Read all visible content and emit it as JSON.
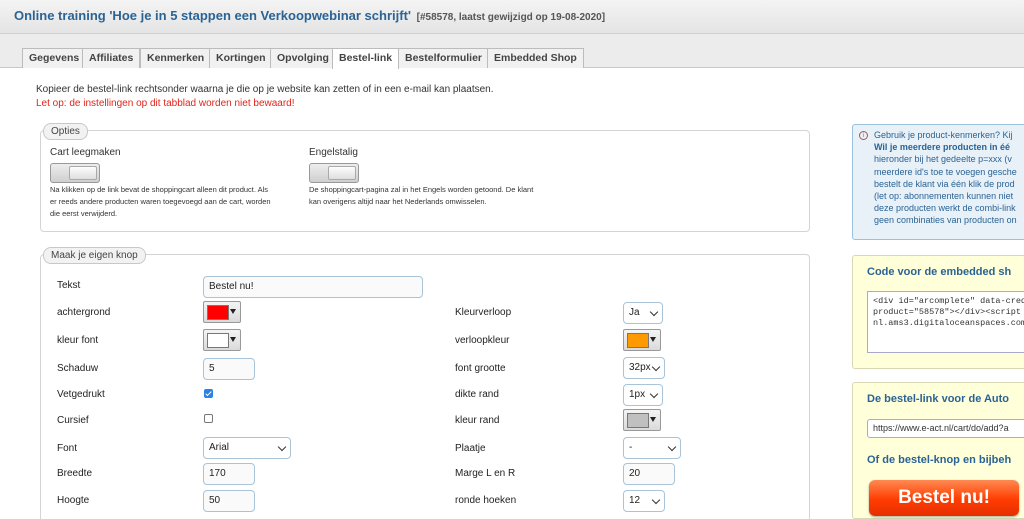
{
  "header": {
    "title": "Online training 'Hoe je in 5 stappen een Verkoopwebinar schrijft'",
    "meta": "[#58578, laatst gewijzigd op 19-08-2020]"
  },
  "tabs": [
    {
      "label": "Gegevens",
      "active": false
    },
    {
      "label": "Affiliates",
      "active": false
    },
    {
      "label": "Kenmerken",
      "active": false
    },
    {
      "label": "Kortingen",
      "active": false
    },
    {
      "label": "Opvolging",
      "active": false
    },
    {
      "label": "Bestel-link",
      "active": true
    },
    {
      "label": "Bestelformulier",
      "active": false
    },
    {
      "label": "Embedded Shop",
      "active": false
    }
  ],
  "intro": "Kopieer de bestel-link rechtsonder waarna je die op je website kan zetten of in een e-mail kan plaatsen.",
  "warning": "Let op: de instellingen op dit tabblad worden niet bewaard!",
  "options": {
    "legend": "Opties",
    "cart_clear": {
      "label": "Cart leegmaken",
      "help": [
        "Na klikken op de link bevat de shoppingcart alleen dit product. Als",
        "er reeds andere producten waren toegevoegd aan de cart, worden",
        "die eerst verwijderd."
      ]
    },
    "english": {
      "label": "Engelstalig",
      "help": [
        "De shoppingcart-pagina zal in het Engels worden getoond. De klant",
        "kan overigens altijd naar het Nederlands omwisselen."
      ]
    }
  },
  "button_builder": {
    "legend": "Maak je eigen knop",
    "text_label": "Tekst",
    "text_value": "Bestel nu!",
    "background_label": "achtergrond",
    "background_color": "#ff0000",
    "font_color_label": "kleur font",
    "font_color": "#ffffff",
    "shadow_label": "Schaduw",
    "shadow_value": "5",
    "bold_label": "Vetgedrukt",
    "bold_checked": true,
    "italic_label": "Cursief",
    "italic_checked": false,
    "font_label": "Font",
    "font_value": "Arial",
    "width_label": "Breedte",
    "width_value": "170",
    "height_label": "Hoogte",
    "height_value": "50",
    "gradient_label": "Kleurverloop",
    "gradient_value": "Ja",
    "gradient_color_label": "verloopkleur",
    "gradient_color": "#ff9900",
    "font_size_label": "font grootte",
    "font_size_value": "32px",
    "border_width_label": "dikte rand",
    "border_width_value": "1px",
    "border_color_label": "kleur rand",
    "border_color": "#c0c0c0",
    "image_label": "Plaatje",
    "image_value": "-",
    "margin_label": "Marge L en R",
    "margin_value": "20",
    "radius_label": "ronde hoeken",
    "radius_value": "12"
  },
  "info_panel": {
    "lines": [
      "Gebruik je product-kenmerken? Kij",
      "Wil je meerdere producten in éé",
      "hieronder bij het gedeelte p=xxx (v",
      "meerdere id's toe te voegen gesche",
      "bestelt de klant via één klik de prod",
      "(let op: abonnementen kunnen niet",
      "deze producten werkt de combi-link",
      "geen combinaties van producten on"
    ]
  },
  "embed_panel": {
    "title": "Code voor de embedded sh",
    "code": [
      "<div id=\"arcomplete\" data-cred=\"2:",
      "product=\"58578\"></div><script sr",
      "nl.ams3.digitaloceanspaces.com/em"
    ]
  },
  "link_panel": {
    "title": "De bestel-link voor de Auto",
    "link": "https://www.e-act.nl/cart/do/add?a",
    "button_title": "Of de bestel-knop en bijbeh",
    "button_label": "Bestel nu!"
  }
}
